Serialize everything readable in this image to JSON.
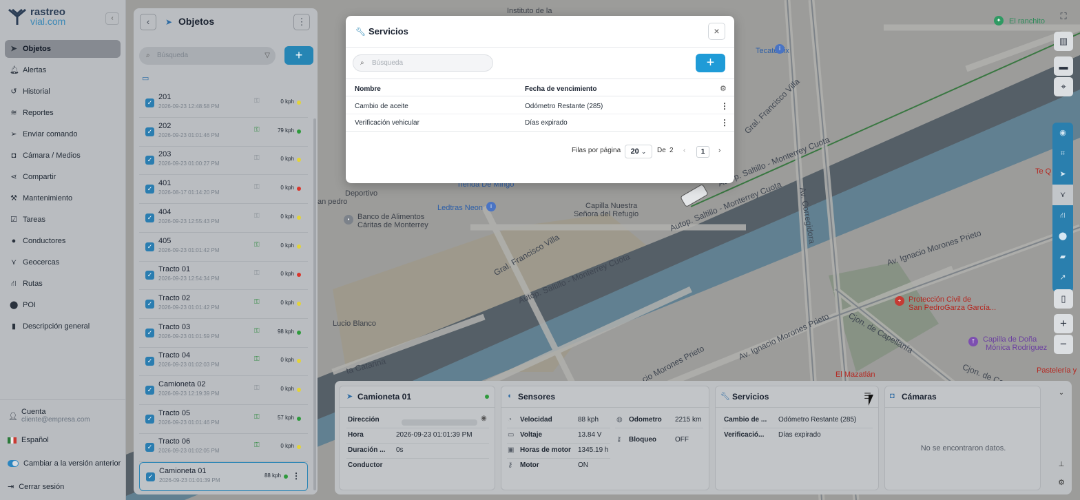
{
  "brand": {
    "line1": "rastreo",
    "line2": "vial.com"
  },
  "sidebar": {
    "items": [
      {
        "label": "Objetos",
        "icon": "navigation-arrow-icon",
        "active": true
      },
      {
        "label": "Alertas",
        "icon": "bell-icon"
      },
      {
        "label": "Historial",
        "icon": "history-icon"
      },
      {
        "label": "Reportes",
        "icon": "layers-icon"
      },
      {
        "label": "Enviar comando",
        "icon": "send-icon"
      },
      {
        "label": "Cámara / Medios",
        "icon": "camera-icon"
      },
      {
        "label": "Compartir",
        "icon": "share-icon"
      },
      {
        "label": "Mantenimiento",
        "icon": "wrench-icon"
      },
      {
        "label": "Tareas",
        "icon": "tasks-icon"
      },
      {
        "label": "Conductores",
        "icon": "users-icon"
      },
      {
        "label": "Geocercas",
        "icon": "geofence-icon"
      },
      {
        "label": "Rutas",
        "icon": "route-icon"
      },
      {
        "label": "POI",
        "icon": "pin-icon"
      },
      {
        "label": "Descripción general",
        "icon": "bar-chart-icon"
      }
    ],
    "account_label": "Cuenta",
    "account_email": "cliente@empresa.com",
    "language": "Español",
    "switch_version": "Cambiar a la versión anterior",
    "logout": "Cerrar sesión"
  },
  "objects_panel": {
    "title": "Objetos",
    "search_placeholder": "Búsqueda",
    "rows": [
      {
        "name": "201",
        "time": "2026-09-23 12:48:58 PM",
        "speed": "0 kph",
        "status": "#e2d33a",
        "engine": false
      },
      {
        "name": "202",
        "time": "2026-09-23 01:01:46 PM",
        "speed": "79 kph",
        "status": "#2e9a3c",
        "engine": true
      },
      {
        "name": "203",
        "time": "2026-09-23 01:00:27 PM",
        "speed": "0 kph",
        "status": "#e2d33a",
        "engine": false
      },
      {
        "name": "401",
        "time": "2026-08-17 01:14:20 PM",
        "speed": "0 kph",
        "status": "#d9352b",
        "engine": false
      },
      {
        "name": "404",
        "time": "2026-09-23 12:55:43 PM",
        "speed": "0 kph",
        "status": "#e2d33a",
        "engine": false
      },
      {
        "name": "405",
        "time": "2026-09-23 01:01:42 PM",
        "speed": "0 kph",
        "status": "#e2d33a",
        "engine": true
      },
      {
        "name": "Tracto 01",
        "time": "2026-09-23 12:54:34 PM",
        "speed": "0 kph",
        "status": "#d9352b",
        "engine": false
      },
      {
        "name": "Tracto 02",
        "time": "2026-09-23 01:01:42 PM",
        "speed": "0 kph",
        "status": "#e2d33a",
        "engine": true
      },
      {
        "name": "Tracto 03",
        "time": "2026-09-23 01:01:59 PM",
        "speed": "98 kph",
        "status": "#2e9a3c",
        "engine": true
      },
      {
        "name": "Tracto 04",
        "time": "2026-09-23 01:02:03 PM",
        "speed": "0 kph",
        "status": "#e2d33a",
        "engine": true
      },
      {
        "name": "Camioneta 02",
        "time": "2026-09-23 12:19:39 PM",
        "speed": "0 kph",
        "status": "#e2d33a",
        "engine": false
      },
      {
        "name": "Tracto 05",
        "time": "2026-09-23 01:01:46 PM",
        "speed": "57 kph",
        "status": "#2e9a3c",
        "engine": true
      },
      {
        "name": "Tracto 06",
        "time": "2026-09-23 01:02:05 PM",
        "speed": "0 kph",
        "status": "#e2d33a",
        "engine": true
      },
      {
        "name": "Camioneta 01",
        "time": "2026-09-23 01:01:39 PM",
        "speed": "88 kph",
        "status": "#2e9a3c",
        "engine": false,
        "selected": true
      }
    ]
  },
  "modal": {
    "title": "Servicios",
    "search_placeholder": "Búsqueda",
    "col_name": "Nombre",
    "col_due": "Fecha de vencimiento",
    "rows": [
      {
        "name": "Cambio de aceite",
        "due": "Odómetro Restante (285)"
      },
      {
        "name": "Verificación vehicular",
        "due": "Días expirado"
      }
    ],
    "rows_per_page_label": "Filas por página",
    "rows_per_page": "20",
    "of_label": "De",
    "total_pages": "2",
    "current_page": "1"
  },
  "vehicle_card": {
    "title": "Camioneta 01",
    "fields": [
      {
        "k": "Dirección",
        "v": ""
      },
      {
        "k": "Hora",
        "v": "2026-09-23 01:01:39 PM"
      },
      {
        "k": "Duración ...",
        "v": "0s"
      },
      {
        "k": "Conductor",
        "v": ""
      }
    ]
  },
  "sensors_card": {
    "title": "Sensores",
    "left": [
      {
        "k": "Velocidad",
        "v": "88 kph",
        "icon": "speedometer-icon"
      },
      {
        "k": "Voltaje",
        "v": "13.84 V",
        "icon": "battery-icon"
      },
      {
        "k": "Horas de motor",
        "v": "1345.19 h",
        "icon": "engine-icon"
      },
      {
        "k": "Motor",
        "v": "ON",
        "icon": "key-icon"
      }
    ],
    "right": [
      {
        "k": "Odometro",
        "v": "2215 km",
        "icon": "odometer-icon"
      },
      {
        "k": "Bloqueo",
        "v": "OFF",
        "icon": "key-icon"
      }
    ]
  },
  "services_card": {
    "title": "Servicios",
    "rows": [
      {
        "k": "Cambio de ...",
        "v": "Odómetro Restante (285)"
      },
      {
        "k": "Verificació...",
        "v": "Días expirado"
      }
    ]
  },
  "cameras_card": {
    "title": "Cámaras",
    "empty": "No se encontraron datos."
  },
  "map": {
    "labels": [
      {
        "t": "Instituto de la",
        "cls": ""
      },
      {
        "t": "El ranchito",
        "cls": "green"
      },
      {
        "t": "Tecate six",
        "cls": "blue"
      },
      {
        "t": "Deportivo",
        "cls": ""
      },
      {
        "t": "an pedro",
        "cls": ""
      },
      {
        "t": "Tienda De Mingo",
        "cls": "blue"
      },
      {
        "t": "Ledtras Neon",
        "cls": "blue"
      },
      {
        "t": "Banco de Alimentos",
        "cls": ""
      },
      {
        "t": "Cáritas de Monterrey",
        "cls": ""
      },
      {
        "t": "Capilla Nuestra",
        "cls": ""
      },
      {
        "t": "Señora del Refugio",
        "cls": ""
      },
      {
        "t": "Protección Civil de",
        "cls": "red"
      },
      {
        "t": "San PedroGarza García...",
        "cls": "red"
      },
      {
        "t": "Capilla de Doña",
        "cls": "purple"
      },
      {
        "t": "Mónica Rodríguez",
        "cls": "purple"
      },
      {
        "t": "Lucio Blanco",
        "cls": ""
      },
      {
        "t": "El Mazatlán",
        "cls": "red"
      },
      {
        "t": "Pastelería y",
        "cls": "red"
      },
      {
        "t": "Te Q",
        "cls": "red"
      }
    ],
    "roads": [
      "Autop. Saltillo - Monterrey Cuota",
      "Autop. Saltillo - Monterrey Cuota",
      "Autop. Saltillo - Monterrey Cuota",
      "Gral. Francisco Villa",
      "Gral. Francisco Villa",
      "Av. Corregidora",
      "Av. Ignacio Morones Prieto",
      "Av. Ignacio Morones Prieto",
      "cio Morones Prieto",
      "Cjon. de Capellanía",
      "Cjon. de Ca",
      "ta Catarina"
    ],
    "shields": [
      "40D",
      "40D",
      "40D",
      "40D",
      "20"
    ]
  }
}
